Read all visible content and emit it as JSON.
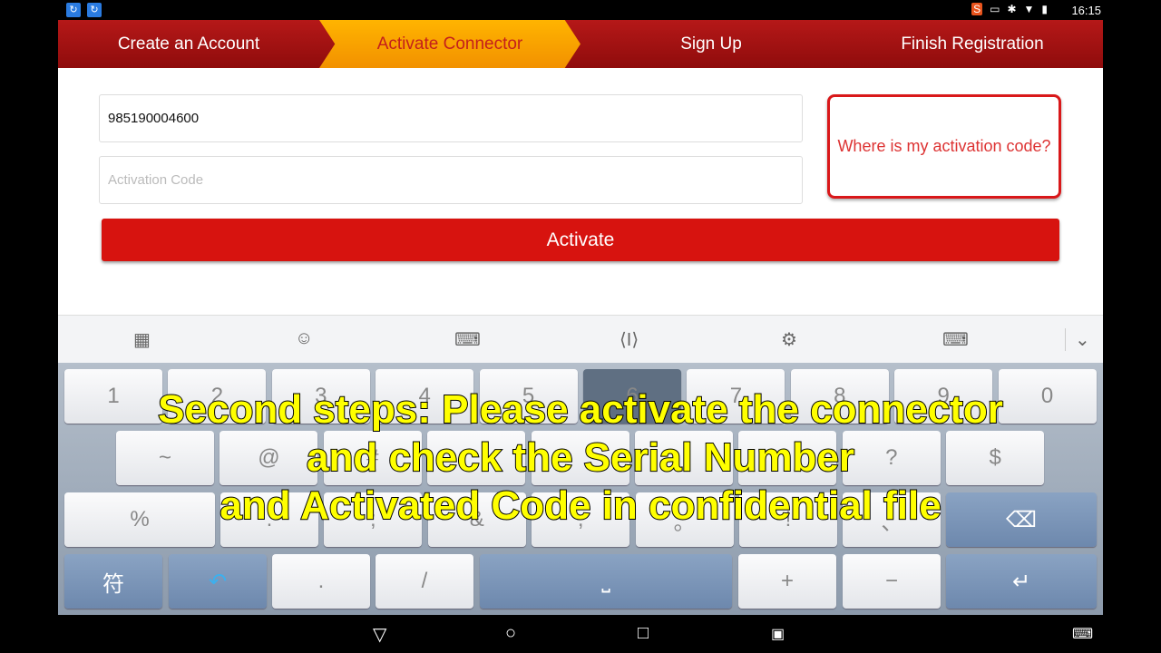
{
  "status_bar": {
    "time": "16:15",
    "icons": [
      "app-icon",
      "app-icon",
      "sogou-icon",
      "cast-icon",
      "bluetooth-icon",
      "wifi-icon",
      "battery-icon"
    ]
  },
  "steps": [
    {
      "label": "Create an Account",
      "active": false
    },
    {
      "label": "Activate Connector",
      "active": true
    },
    {
      "label": "Sign Up",
      "active": false
    },
    {
      "label": "Finish Registration",
      "active": false
    }
  ],
  "form": {
    "serial_value": "985190004600",
    "activation_placeholder": "Activation Code",
    "where_link": "Where is my activation code?",
    "activate_label": "Activate"
  },
  "keyboard": {
    "toolbar": [
      "grid-icon",
      "emoji-icon",
      "keyboard-icon",
      "cursor-icon",
      "gear-icon",
      "keyboard-settings-icon",
      "chevron-down-icon"
    ],
    "row1": [
      "1",
      "2",
      "3",
      "4",
      "5",
      "6",
      "7",
      "8",
      "9",
      "0"
    ],
    "row2": [
      "~",
      "@",
      "#",
      "",
      "",
      "",
      "",
      "?",
      "$"
    ],
    "row3": [
      "%",
      ".",
      ";",
      "&",
      ",",
      "。",
      "!",
      "、"
    ],
    "row4": {
      "sym": "符",
      "dot": ".",
      "slash": "/",
      "plus": "+",
      "minus": "−"
    }
  },
  "subtitle": [
    "Second steps: Please activate the connector",
    "and check the Serial Number",
    "and Activated Code in confidential file"
  ],
  "colors": {
    "header_red": "#b51818",
    "active_step": "#ffb400",
    "activate_button": "#d7130f",
    "subtitle": "#ffff00"
  }
}
